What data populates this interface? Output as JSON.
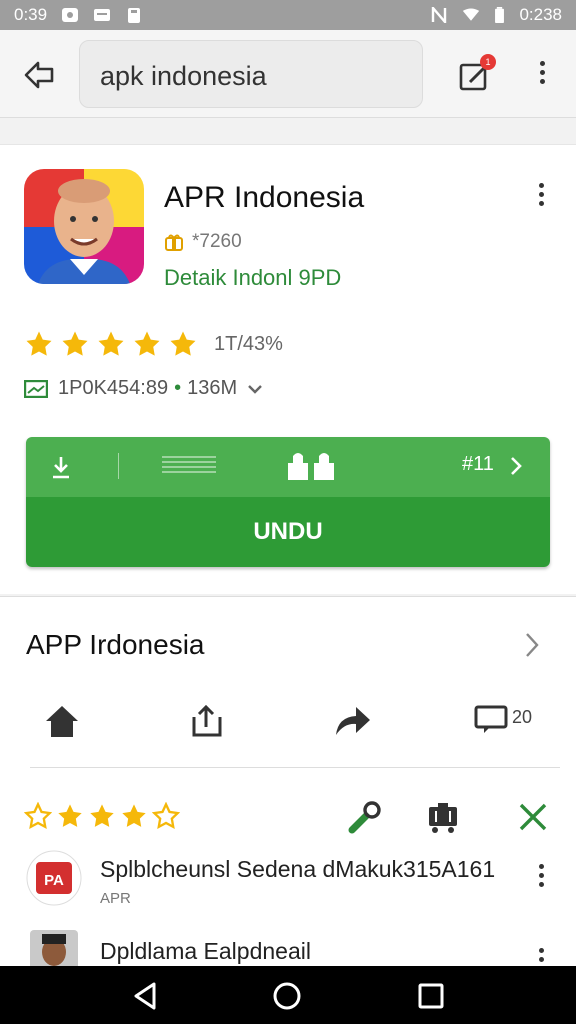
{
  "status_bar": {
    "time_left": "0:39",
    "time_right": "0:238",
    "icons": [
      "image-icon",
      "message-icon",
      "clipboard-icon",
      "no-sim-icon",
      "wifi-icon",
      "battery-icon"
    ]
  },
  "search": {
    "query": "apk indonesia",
    "badge_count": "1"
  },
  "app": {
    "title": "APR Indonesia",
    "rating_text": "*7260",
    "developer": "Detaik Indonl 9PD",
    "stars_text": "1T/43%",
    "info_text": "1P0K454:89",
    "size_text": "136M"
  },
  "install": {
    "count": "#11",
    "label": "UNDU"
  },
  "section": {
    "title": "APP Irdonesia",
    "chat_count": "20"
  },
  "reviews": [
    {
      "text": "Splblcheunsl Sedena dMakuk315A161",
      "sub": "APR"
    },
    {
      "text": "Dpldlama Ealpdneail",
      "sub": ""
    }
  ],
  "colors": {
    "accent_green": "#2e9b36",
    "install_top": "#4caf50",
    "dev_green": "#2e8b3a",
    "star_yellow": "#f5b80a"
  }
}
